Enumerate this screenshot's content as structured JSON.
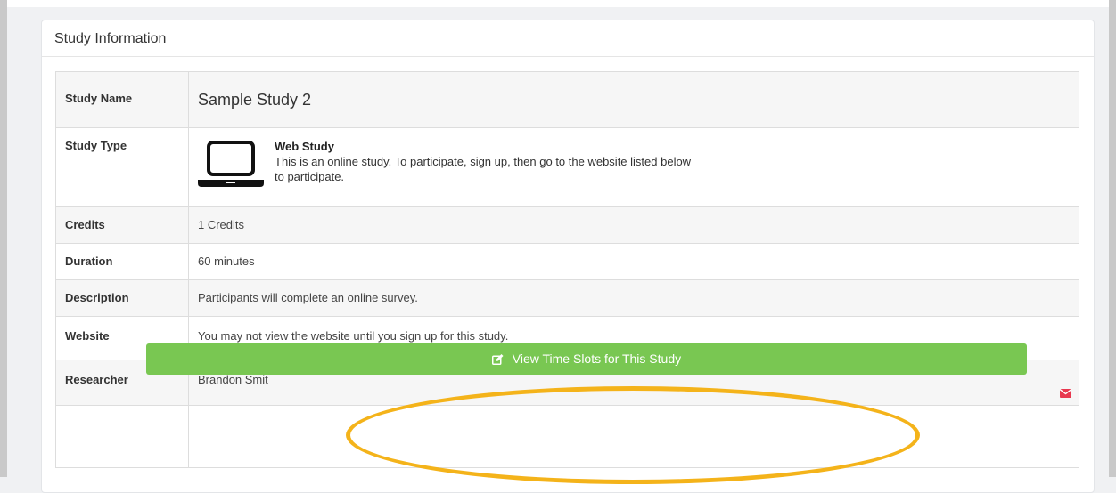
{
  "panel": {
    "title": "Study Information"
  },
  "rows": {
    "study_name": {
      "label": "Study Name",
      "value": "Sample Study 2"
    },
    "study_type": {
      "label": "Study Type",
      "type_title": "Web Study",
      "type_desc": "This is an online study. To participate, sign up, then go to the website listed below to participate.",
      "icon": "laptop-icon"
    },
    "credits": {
      "label": "Credits",
      "value": "1 Credits"
    },
    "duration": {
      "label": "Duration",
      "value": "60 minutes"
    },
    "description": {
      "label": "Description",
      "value": "Participants will complete an online survey."
    },
    "website": {
      "label": "Website",
      "value": "You may not view the website until you sign up for this study."
    },
    "researcher": {
      "label": "Researcher",
      "value": "Brandon Smit",
      "icon": "envelope-icon",
      "icon_color": "#e8384f"
    }
  },
  "action": {
    "label": "View Time Slots for This Study",
    "icon": "edit-icon",
    "color": "#79c752"
  },
  "highlight_color": "#f4b31a"
}
